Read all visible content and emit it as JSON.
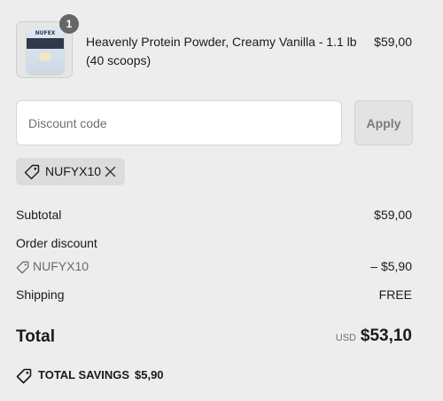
{
  "product": {
    "title": "Heavenly Protein Powder, Creamy Vanilla - 1.1 lb (40 scoops)",
    "price": "$59,00",
    "quantity": "1",
    "image_icon": "product-pouch-image",
    "image_brand": "NUFEX"
  },
  "discount": {
    "placeholder": "Discount code",
    "value": "",
    "apply_label": "Apply",
    "applied_code": "NUFYX10",
    "tag_icon": "tag-icon",
    "remove_icon": "close-icon"
  },
  "summary": {
    "subtotal_label": "Subtotal",
    "subtotal_value": "$59,00",
    "order_discount_label": "Order discount",
    "discount_code": "NUFYX10",
    "discount_value": "– $5,90",
    "shipping_label": "Shipping",
    "shipping_value": "FREE",
    "total_label": "Total",
    "currency": "USD",
    "total_value": "$53,10",
    "savings_label": "TOTAL SAVINGS",
    "savings_value": "$5,90"
  },
  "colors": {
    "page_bg": "#ededed",
    "badge_bg": "#666666",
    "muted_text": "#6b6b6b"
  }
}
